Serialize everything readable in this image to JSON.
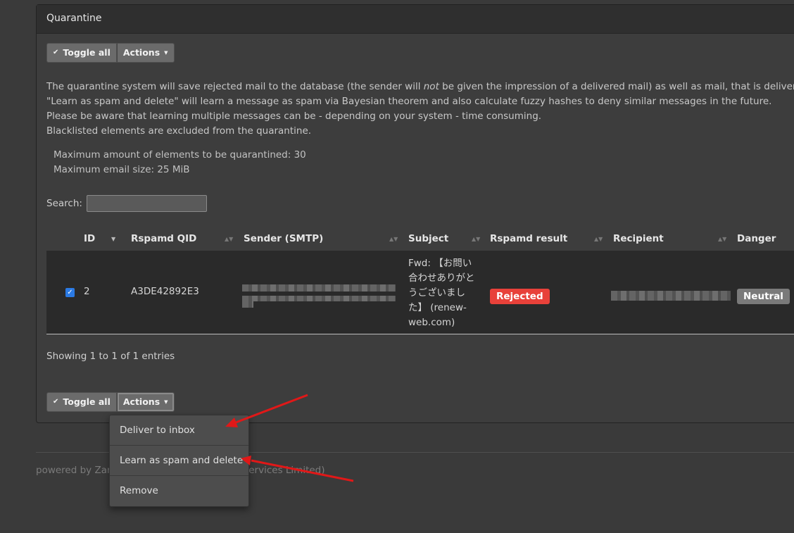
{
  "panel": {
    "title": "Quarantine"
  },
  "toolbar": {
    "toggle_label": "Toggle all",
    "actions_label": "Actions"
  },
  "info": {
    "line1_pre": "The quarantine system will save rejected mail to the database (the sender will ",
    "line1_em": "not",
    "line1_post": " be given the impression of a delivered mail) as well as mail, that is delivered as c",
    "line2": "\"Learn as spam and delete\" will learn a message as spam via Bayesian theorem and also calculate fuzzy hashes to deny similar messages in the future.",
    "line3": "Please be aware that learning multiple messages can be - depending on your system - time consuming.",
    "line4": "Blacklisted elements are excluded from the quarantine."
  },
  "limits": {
    "max_elements": "Maximum amount of elements to be quarantined: 30",
    "max_size": "Maximum email size: 25 MiB"
  },
  "search": {
    "label": "Search:",
    "value": ""
  },
  "table": {
    "headers": [
      "ID",
      "Rspamd QID",
      "Sender (SMTP)",
      "Subject",
      "Rspamd result",
      "Recipient",
      "Danger"
    ],
    "rows": [
      {
        "checked": true,
        "id": "2",
        "qid": "A3DE42892E3",
        "subject": "Fwd: 【お問い合わせありがとうございました】 (renew-web.com)",
        "rspamd_result": "Rejected",
        "danger": "Neutral"
      }
    ]
  },
  "showing": "Showing 1 to 1 of 1 entries",
  "dropdown": {
    "items": [
      "Deliver to inbox",
      "Learn as spam and delete",
      "Remove"
    ]
  },
  "footer": {
    "left": "powered by Zar",
    "right": "AJRB Services Limited)"
  },
  "colors": {
    "rejected": "#e8413a",
    "neutral": "#7a7a7a",
    "annotation_arrow": "#e01818",
    "checkbox": "#2b7ae4"
  }
}
